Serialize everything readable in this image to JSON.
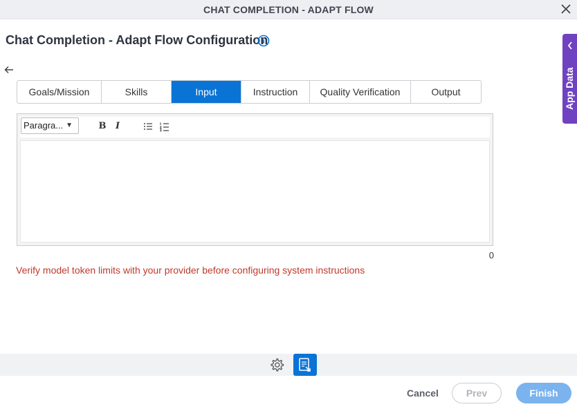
{
  "window": {
    "title": "CHAT COMPLETION - ADAPT FLOW"
  },
  "header": {
    "heading": "Chat Completion - Adapt Flow Configuration"
  },
  "tabs": [
    {
      "label": "Goals/Mission",
      "active": false
    },
    {
      "label": "Skills",
      "active": false
    },
    {
      "label": "Input",
      "active": true
    },
    {
      "label": "Instruction",
      "active": false
    },
    {
      "label": "Quality Verification",
      "active": false
    },
    {
      "label": "Output",
      "active": false
    }
  ],
  "editor": {
    "format_value": "Paragra...",
    "content": "",
    "char_count": "0"
  },
  "warning": "Verify model token limits with your provider before configuring system instructions",
  "side_panel": {
    "label": "App Data"
  },
  "footer": {
    "cancel": "Cancel",
    "prev": "Prev",
    "finish": "Finish"
  },
  "colors": {
    "accent": "#0a74d6",
    "side_panel": "#6f42c1",
    "warning": "#c0392b",
    "finish_disabled": "#7ab3ee"
  }
}
